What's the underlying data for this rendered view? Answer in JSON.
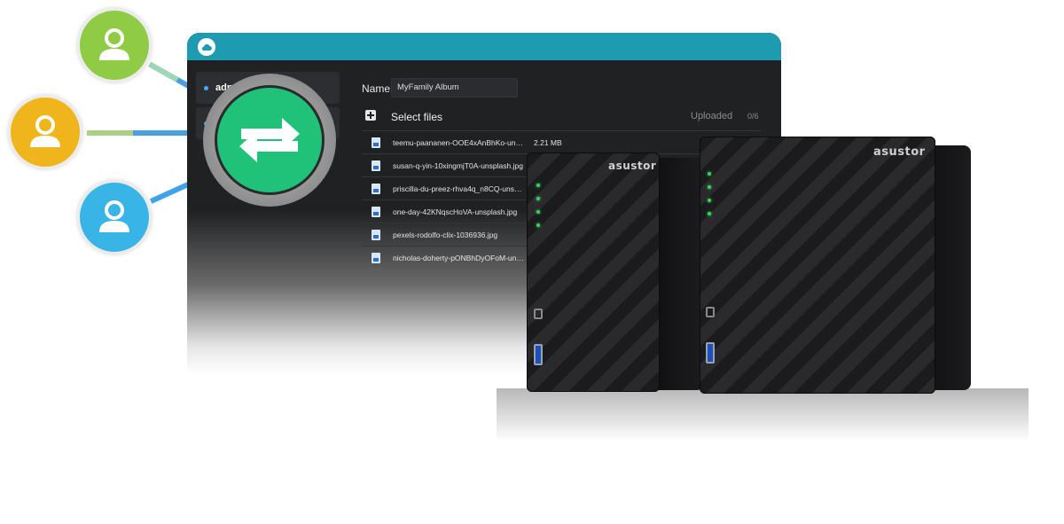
{
  "window": {
    "sidebar": {
      "items": [
        {
          "label": "admi"
        },
        {
          "label": ""
        }
      ]
    },
    "form": {
      "name_label": "Name",
      "name_value": "MyFamily Album"
    },
    "toolbar": {
      "select_files_label": "Select files",
      "uploaded_label": "Uploaded",
      "uploaded_count": "0/6"
    },
    "files": [
      {
        "name": "teemu-paananen-OOE4xAnBhKo-uns…",
        "size": "2.21 MB"
      },
      {
        "name": "susan-q-yin-10xingmjT0A-unsplash.jpg",
        "size": ""
      },
      {
        "name": "priscilla-du-preez-rhva4q_n8CQ-unsp…",
        "size": ""
      },
      {
        "name": "one-day-42KNqscHoVA-unsplash.jpg",
        "size": ""
      },
      {
        "name": "pexels-rodolfo-clix-1036936.jpg",
        "size": ""
      },
      {
        "name": "nicholas-doherty-pONBhDyOFoM-un…",
        "size": ""
      }
    ]
  },
  "devices": {
    "brand_left": "asustor",
    "brand_right": "asustor"
  },
  "colors": {
    "titlebar": "#1e9bb1",
    "user_green": "#8fcb45",
    "user_yellow": "#f0b51c",
    "user_blue": "#38b5e6",
    "hub_green": "#1fc278"
  },
  "icons": [
    "cloud-icon",
    "add-icon",
    "file-icon",
    "close-icon",
    "user-icon",
    "transfer-icon"
  ]
}
